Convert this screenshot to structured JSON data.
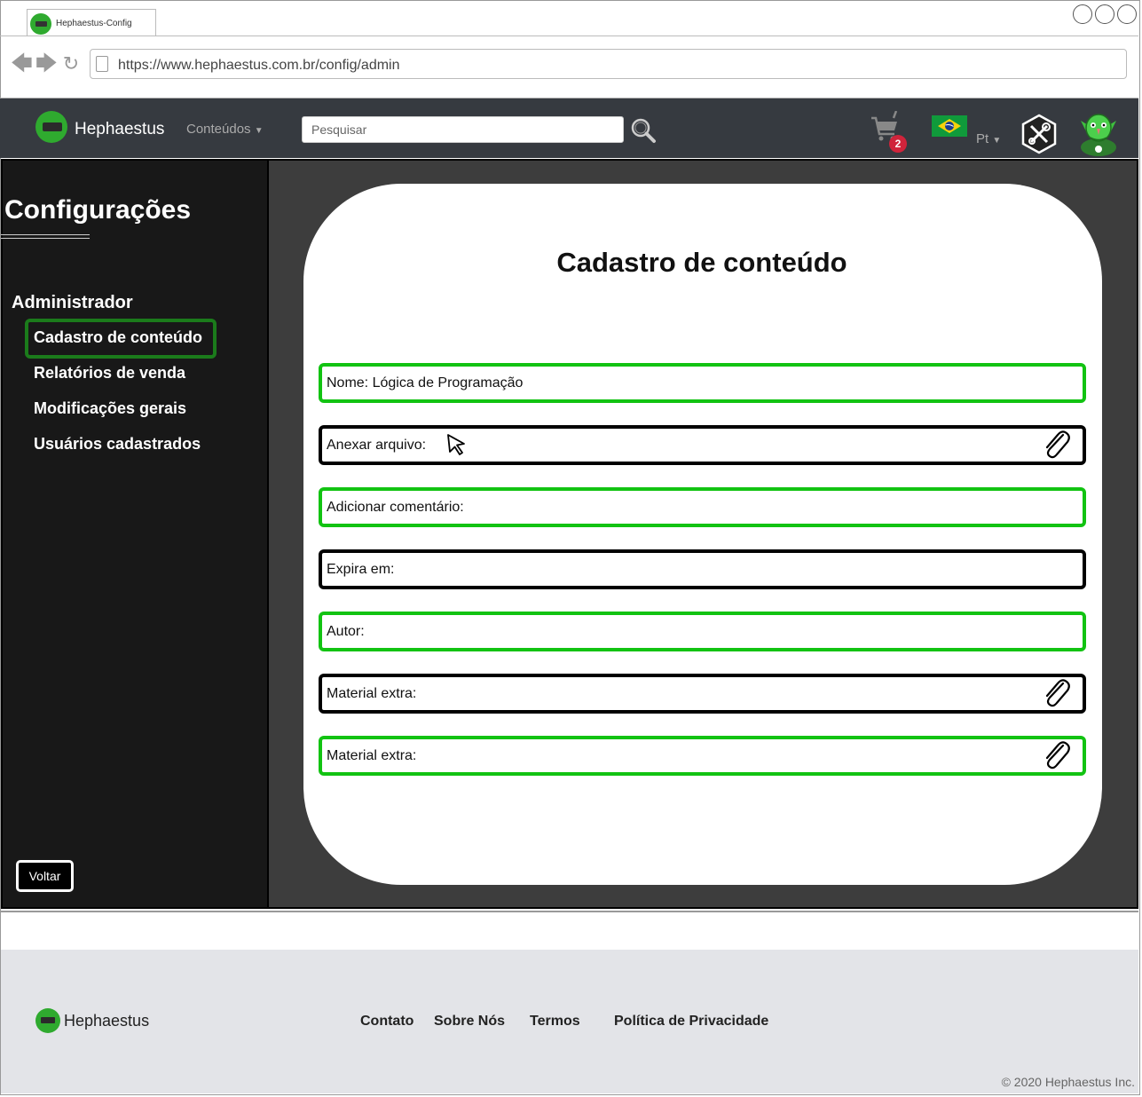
{
  "browser": {
    "tab_title": "Hephaestus-Config",
    "url": "https://www.hephaestus.com.br/config/admin"
  },
  "navbar": {
    "brand": "Hephaestus",
    "menu_label": "Conteúdos",
    "search_placeholder": "Pesquisar",
    "cart_count": "2",
    "language": "Pt"
  },
  "sidebar": {
    "title": "Configurações",
    "section": "Administrador",
    "items": [
      {
        "label": "Cadastro de conteúdo",
        "active": true
      },
      {
        "label": "Relatórios de venda"
      },
      {
        "label": "Modificações gerais"
      },
      {
        "label": "Usuários cadastrados"
      }
    ],
    "back_label": "Voltar"
  },
  "form": {
    "title": "Cadastro de conteúdo",
    "fields": [
      {
        "label": "Nome: Lógica de Programação",
        "style": "green"
      },
      {
        "label": "Anexar arquivo:",
        "style": "black",
        "attachment": true
      },
      {
        "label": "Adicionar comentário:",
        "style": "green"
      },
      {
        "label": "Expira em:",
        "style": "black"
      },
      {
        "label": "Autor:",
        "style": "green"
      },
      {
        "label": "Material extra:",
        "style": "black",
        "attachment": true
      },
      {
        "label": "Material extra:",
        "style": "green",
        "attachment": true
      }
    ]
  },
  "footer": {
    "brand": "Hephaestus",
    "links": [
      "Contato",
      "Sobre Nós",
      "Termos",
      "Política de Privacidade"
    ],
    "copyright": "© 2020 Hephaestus Inc."
  },
  "colors": {
    "navbar_bg": "#363a40",
    "accent_green": "#12c312",
    "active_border": "#1b7b1b",
    "badge_red": "#d0243b"
  }
}
